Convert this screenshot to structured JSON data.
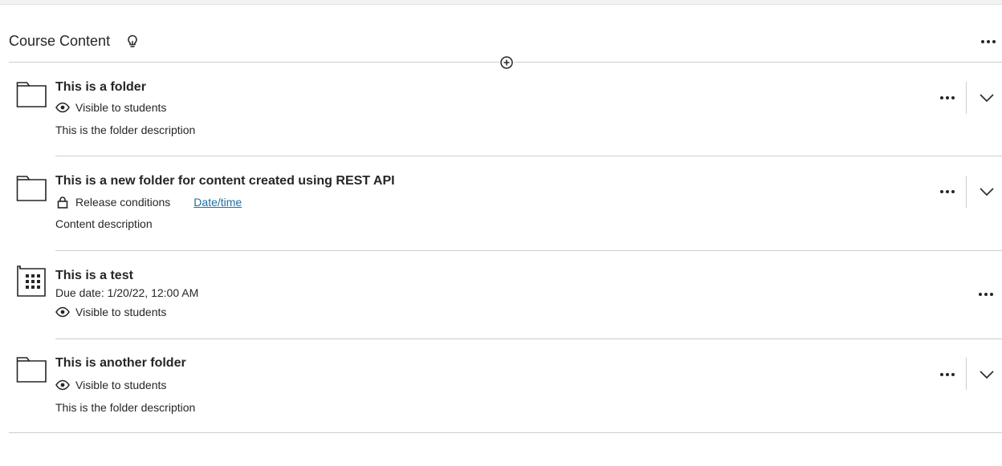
{
  "header": {
    "title": "Course Content",
    "title_icon": "lightbulb-icon",
    "more_icon": "more-options-icon",
    "add_icon": "add-content-icon"
  },
  "items": [
    {
      "type_icon": "folder-icon",
      "title": "This is a folder",
      "status_icon": "eye-icon",
      "status": "Visible to students",
      "description": "This is the folder description",
      "expandable": true
    },
    {
      "type_icon": "folder-icon",
      "title": "This is a new folder for content created using REST API",
      "status_icon": "lock-icon",
      "status": "Release conditions",
      "status_link": "Date/time",
      "description": "Content description",
      "expandable": true
    },
    {
      "type_icon": "test-icon",
      "title": "This is a test",
      "due": "Due date: 1/20/22, 12:00 AM",
      "status_icon": "eye-icon",
      "status": "Visible to students",
      "expandable": false
    },
    {
      "type_icon": "folder-icon",
      "title": "This is another folder",
      "status_icon": "eye-icon",
      "status": "Visible to students",
      "description": "This is the folder description",
      "expandable": true
    }
  ],
  "colors": {
    "text": "#262626",
    "link": "#1a6fa3",
    "divider": "#cdcdcd"
  }
}
